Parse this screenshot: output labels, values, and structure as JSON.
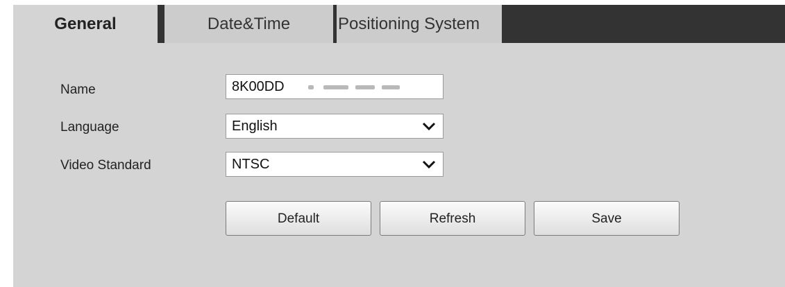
{
  "tabs": {
    "general": "General",
    "datetime": "Date&Time",
    "positioning": "Positioning System"
  },
  "form": {
    "name_label": "Name",
    "name_value": "8K00DD",
    "language_label": "Language",
    "language_value": "English",
    "video_standard_label": "Video Standard",
    "video_standard_value": "NTSC"
  },
  "buttons": {
    "default": "Default",
    "refresh": "Refresh",
    "save": "Save"
  },
  "icons": {
    "select_caret": "chevron-down-icon"
  }
}
